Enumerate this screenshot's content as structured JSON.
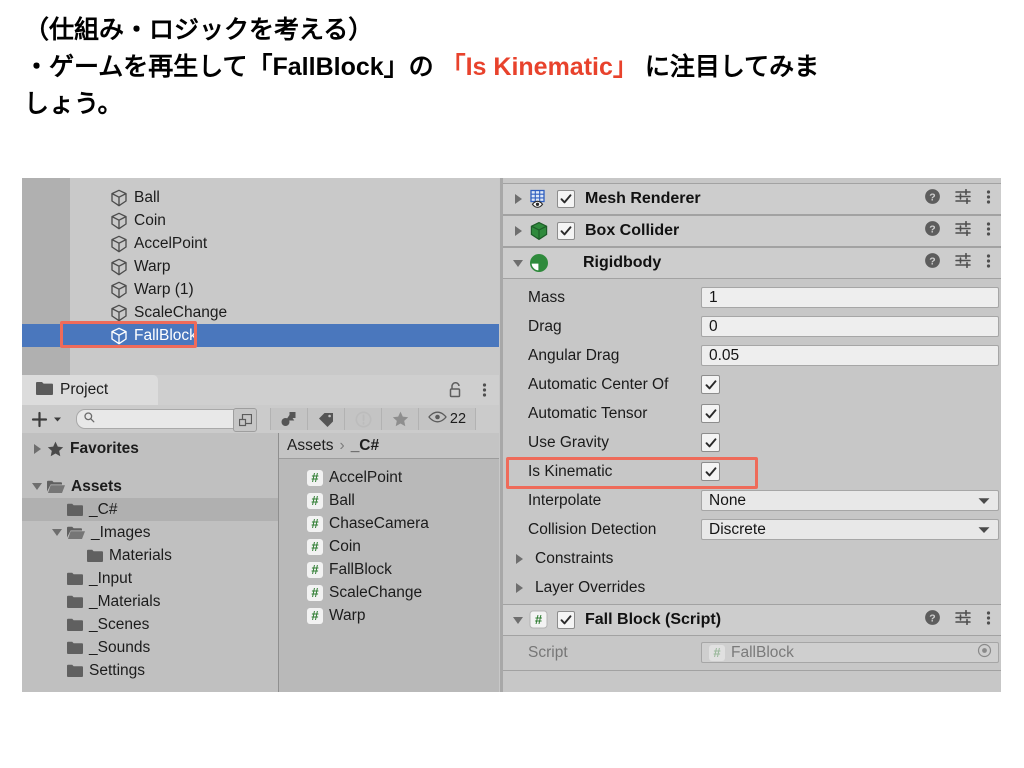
{
  "caption": {
    "line1": "（仕組み・ロジックを考える）",
    "line2_a": "・ゲームを再生して「FallBlock」の ",
    "line2_hl": "「Is Kinematic」",
    "line2_b": " に注目してみま",
    "line3": "しょう。",
    "highlight_color": "#e8422c"
  },
  "hierarchy": {
    "items": [
      {
        "label": "Ball",
        "icon": "cube-icon",
        "selected": false
      },
      {
        "label": "Coin",
        "icon": "cube-icon",
        "selected": false
      },
      {
        "label": "AccelPoint",
        "icon": "cube-icon",
        "selected": false
      },
      {
        "label": "Warp",
        "icon": "cube-icon",
        "selected": false
      },
      {
        "label": "Warp (1)",
        "icon": "cube-icon",
        "selected": false
      },
      {
        "label": "ScaleChange",
        "icon": "cube-icon",
        "selected": false
      },
      {
        "label": "FallBlock",
        "icon": "cube-icon",
        "selected": true
      }
    ],
    "selection_color": "#4a77bd"
  },
  "project": {
    "tab_label": "Project",
    "tab_icon": "folder-icon",
    "lock_icon": "lock-icon",
    "menu_icon": "kebab-menu-icon",
    "toolbar": {
      "add_label": "+",
      "search_value": "",
      "search_placeholder": "",
      "visible_count": "22"
    },
    "tree": [
      {
        "label": "Favorites",
        "depth": 0,
        "arrow": "right",
        "icon": "star-icon",
        "bold": true,
        "selected": false
      },
      {
        "label": "Assets",
        "depth": 0,
        "arrow": "down",
        "icon": "folder-open-icon",
        "bold": true,
        "selected": false
      },
      {
        "label": "_C#",
        "depth": 1,
        "arrow": "none",
        "icon": "folder-icon",
        "bold": false,
        "selected": true
      },
      {
        "label": "_Images",
        "depth": 1,
        "arrow": "down",
        "icon": "folder-open-icon",
        "bold": false,
        "selected": false
      },
      {
        "label": "Materials",
        "depth": 2,
        "arrow": "none",
        "icon": "folder-icon",
        "bold": false,
        "selected": false
      },
      {
        "label": "_Input",
        "depth": 1,
        "arrow": "none",
        "icon": "folder-icon",
        "bold": false,
        "selected": false
      },
      {
        "label": "_Materials",
        "depth": 1,
        "arrow": "none",
        "icon": "folder-icon",
        "bold": false,
        "selected": false
      },
      {
        "label": "_Scenes",
        "depth": 1,
        "arrow": "none",
        "icon": "folder-icon",
        "bold": false,
        "selected": false
      },
      {
        "label": "_Sounds",
        "depth": 1,
        "arrow": "none",
        "icon": "folder-icon",
        "bold": false,
        "selected": false
      },
      {
        "label": "Settings",
        "depth": 1,
        "arrow": "none",
        "icon": "folder-icon",
        "bold": false,
        "selected": false
      }
    ],
    "breadcrumb": {
      "root": "Assets",
      "separator": "›",
      "current": "_C#"
    },
    "assets": [
      {
        "label": "AccelPoint",
        "icon": "csharp-script-icon"
      },
      {
        "label": "Ball",
        "icon": "csharp-script-icon"
      },
      {
        "label": "ChaseCamera",
        "icon": "csharp-script-icon"
      },
      {
        "label": "Coin",
        "icon": "csharp-script-icon"
      },
      {
        "label": "FallBlock",
        "icon": "csharp-script-icon"
      },
      {
        "label": "ScaleChange",
        "icon": "csharp-script-icon"
      },
      {
        "label": "Warp",
        "icon": "csharp-script-icon"
      }
    ]
  },
  "inspector": {
    "components": [
      {
        "title": "Mesh Renderer",
        "icon": "mesh-renderer-icon",
        "expanded": false,
        "enabled": true,
        "has_checkbox": true
      },
      {
        "title": "Box Collider",
        "icon": "box-collider-icon",
        "expanded": false,
        "enabled": true,
        "has_checkbox": true
      },
      {
        "title": "Rigidbody",
        "icon": "rigidbody-icon",
        "expanded": true,
        "enabled": true,
        "has_checkbox": false
      },
      {
        "title": "Fall Block (Script)",
        "icon": "csharp-script-icon",
        "expanded": true,
        "enabled": true,
        "has_checkbox": true
      }
    ],
    "header_icons": {
      "help": "help-icon",
      "preset": "preset-icon",
      "menu": "kebab-menu-icon"
    },
    "rigidbody_properties": [
      {
        "label": "Mass",
        "type": "text",
        "value": "1"
      },
      {
        "label": "Drag",
        "type": "text",
        "value": "0"
      },
      {
        "label": "Angular Drag",
        "type": "text",
        "value": "0.05"
      },
      {
        "label": "Automatic Center Of",
        "type": "checkbox",
        "checked": true
      },
      {
        "label": "Automatic Tensor",
        "type": "checkbox",
        "checked": true
      },
      {
        "label": "Use Gravity",
        "type": "checkbox",
        "checked": true
      },
      {
        "label": "Is Kinematic",
        "type": "checkbox",
        "checked": true,
        "highlighted": true
      },
      {
        "label": "Interpolate",
        "type": "dropdown",
        "value": "None"
      },
      {
        "label": "Collision Detection",
        "type": "dropdown",
        "value": "Discrete"
      }
    ],
    "rigidbody_foldouts": [
      {
        "label": "Constraints",
        "arrow": "right"
      },
      {
        "label": "Layer Overrides",
        "arrow": "right"
      }
    ],
    "script_properties": [
      {
        "label": "Script",
        "type": "object",
        "value": "FallBlock",
        "icon": "csharp-script-icon"
      }
    ]
  }
}
